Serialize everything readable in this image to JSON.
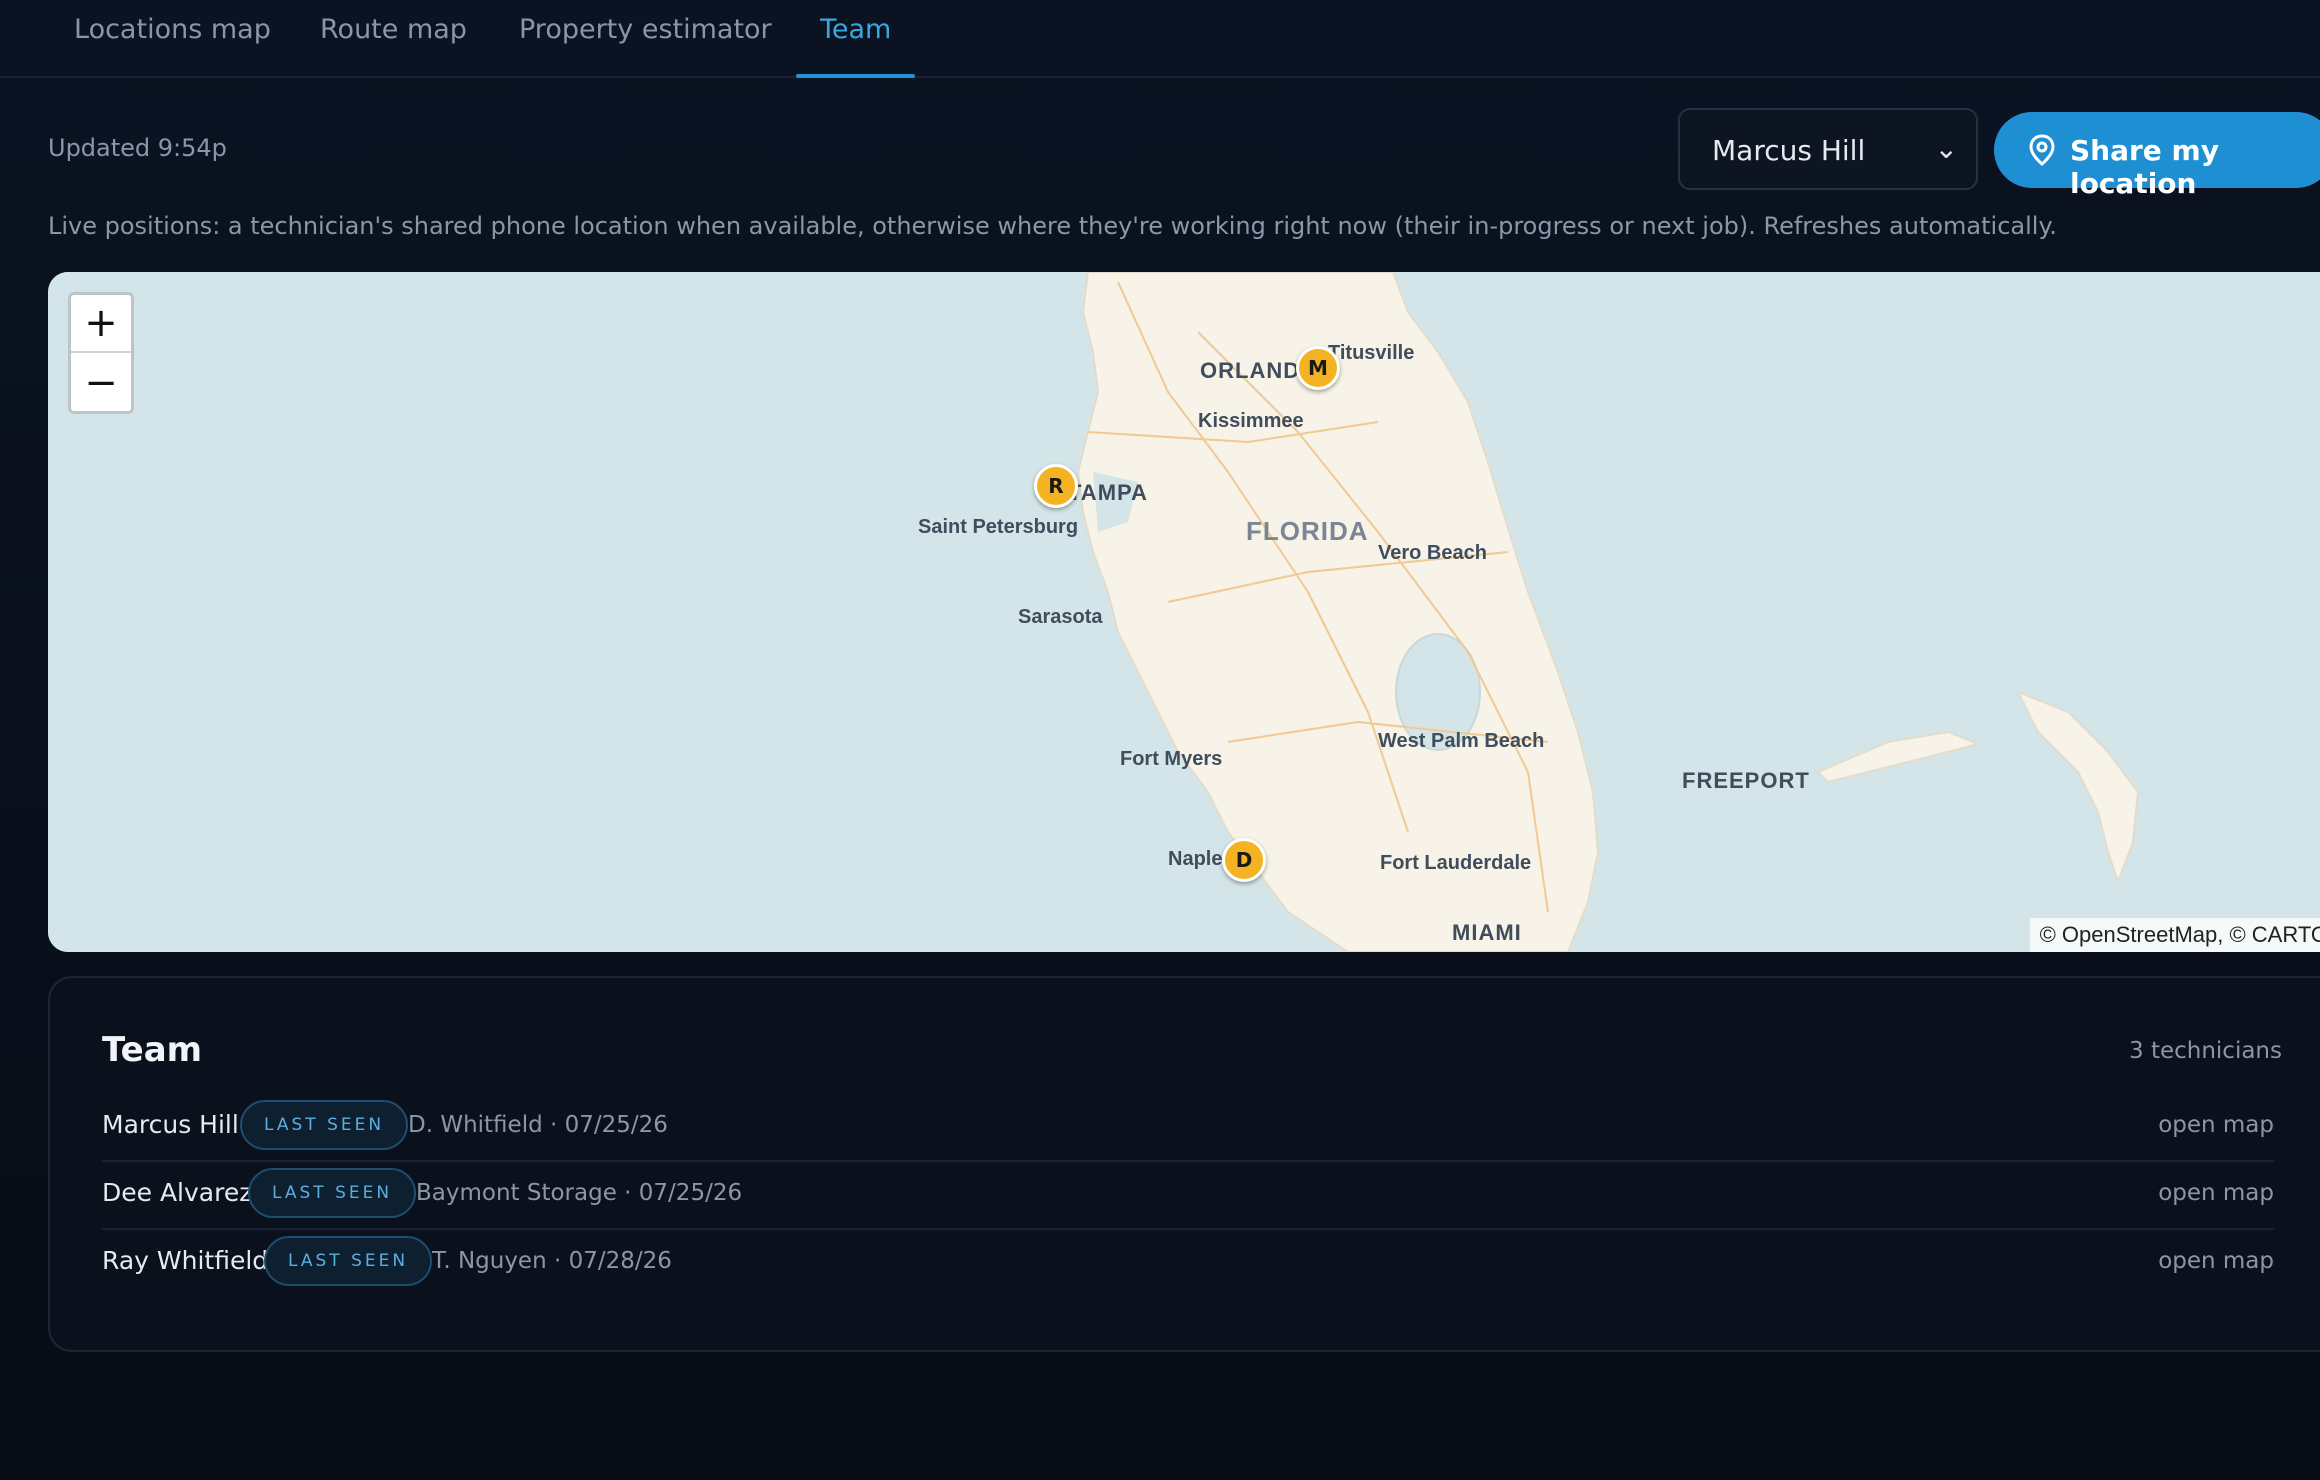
{
  "tabs": [
    {
      "label": "Locations map"
    },
    {
      "label": "Route map"
    },
    {
      "label": "Property estimator"
    },
    {
      "label": "Team"
    }
  ],
  "active_tab": "Team",
  "header": {
    "updated": "Updated 9:54p",
    "technician_select": {
      "selected": "Marcus Hill"
    },
    "share_button": "Share my location"
  },
  "description": "Live positions: a technician's shared phone location when available, otherwise where they're working right now (their in-progress or next job). Refreshes automatically.",
  "map": {
    "zoom_in": "+",
    "zoom_out": "−",
    "attribution": "© OpenStreetMap, © CARTO",
    "labels": {
      "orlando": "ORLANDO",
      "titusville": "Titusville",
      "kissimmee": "Kissimmee",
      "tampa": "TAMPA",
      "saint_petersburg": "Saint Petersburg",
      "florida": "FLORIDA",
      "vero_beach": "Vero Beach",
      "sarasota": "Sarasota",
      "west_palm_beach": "West Palm Beach",
      "freeport": "FREEPORT",
      "fort_myers": "Fort Myers",
      "naples": "Naples",
      "fort_lauderdale": "Fort Lauderdale",
      "miami": "MIAMI"
    },
    "markers": [
      {
        "initial": "M",
        "technician": "Marcus Hill"
      },
      {
        "initial": "R",
        "technician": "Ray Whitfield"
      },
      {
        "initial": "D",
        "technician": "Dee Alvarez"
      }
    ],
    "colors": {
      "water": "#d3e5e8",
      "land": "#f7f3e8",
      "marker": "#f3b322"
    }
  },
  "team": {
    "title": "Team",
    "count": "3 technicians",
    "rows": [
      {
        "name": "Marcus Hill",
        "badge": "LAST SEEN",
        "detail": "D. Whitfield · 07/25/26",
        "action": "open map"
      },
      {
        "name": "Dee Alvarez",
        "badge": "LAST SEEN",
        "detail": "Baymont Storage · 07/25/26",
        "action": "open map"
      },
      {
        "name": "Ray Whitfield",
        "badge": "LAST SEEN",
        "detail": "T. Nguyen · 07/28/26",
        "action": "open map"
      }
    ]
  },
  "colors": {
    "accent": "#2391d6",
    "background": "#070b15"
  }
}
